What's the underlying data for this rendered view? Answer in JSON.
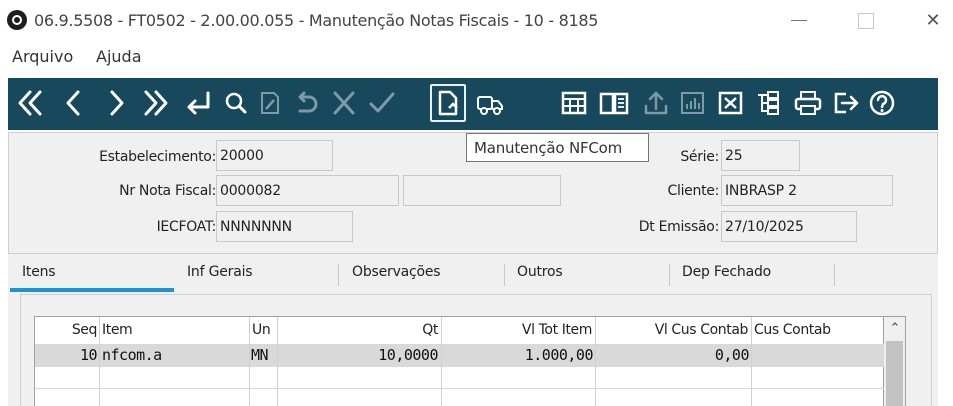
{
  "window": {
    "title": "06.9.5508 - FT0502 - 2.00.00.055 - Manutenção Notas Fiscais - 10 - 8185",
    "close_symbol": "✕"
  },
  "menu": {
    "items": [
      {
        "label": "Arquivo"
      },
      {
        "label": "Ajuda"
      }
    ]
  },
  "toolbar": {
    "icons": [
      "first-record-icon",
      "previous-record-icon",
      "next-record-icon",
      "last-record-icon",
      "go-to-icon",
      "search-icon",
      "edit-icon",
      "undo-icon",
      "cancel-icon",
      "confirm-icon",
      "document-icon",
      "truck-icon",
      "calculator-icon",
      "book-icon",
      "export-icon",
      "chart-icon",
      "delete-icon",
      "tree-icon",
      "print-icon",
      "exit-icon",
      "help-icon"
    ],
    "tooltip": "Manutenção NFCom",
    "color": "#17485c"
  },
  "form": {
    "estabelecimento": {
      "label": "Estabelecimento:",
      "value": "20000"
    },
    "serie": {
      "label": "Série:",
      "value": "25"
    },
    "nr_nota": {
      "label": "Nr Nota Fiscal:",
      "value": "0000082",
      "extra1": "",
      "extra2": ""
    },
    "cliente": {
      "label": "Cliente:",
      "value": "INBRASP  2"
    },
    "iecfoat": {
      "label": "IECFOAT:",
      "value": "NNNNNNN"
    },
    "dt_emissao": {
      "label": "Dt Emissão:",
      "value": "27/10/2025"
    }
  },
  "tabs": [
    {
      "label": "Itens",
      "active": true
    },
    {
      "label": "Inf Gerais",
      "active": false
    },
    {
      "label": "Observações",
      "active": false
    },
    {
      "label": "Outros",
      "active": false
    },
    {
      "label": "Dep Fechado",
      "active": false
    }
  ],
  "grid": {
    "columns": [
      "Seq",
      "Item",
      "Un",
      "Qt",
      "Vl Tot Item",
      "Vl Cus Contab",
      "Cus Contab"
    ],
    "rows": [
      {
        "seq": "10",
        "item": "nfcom.a",
        "un": "MN",
        "qt": "10,0000",
        "vl_tot": "1.000,00",
        "vl_cus": "0,00",
        "cus": ""
      }
    ],
    "scroll_up": "⌃"
  },
  "colors": {
    "accent": "#1a96d6",
    "selected_row": "#d9d9d9"
  }
}
